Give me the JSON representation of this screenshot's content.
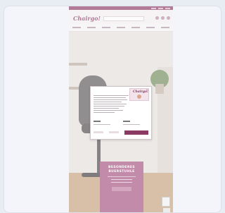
{
  "site": {
    "logo": "Chairgo!",
    "brand_color": "#8a3a63"
  },
  "hero": {
    "promo_line1": "BESONDERES",
    "promo_line2": "BUERSTUHLE"
  },
  "cookie_modal": {
    "logo": "Chairgo!",
    "accept_color": "#8a3a63",
    "close_glyph": "×"
  }
}
